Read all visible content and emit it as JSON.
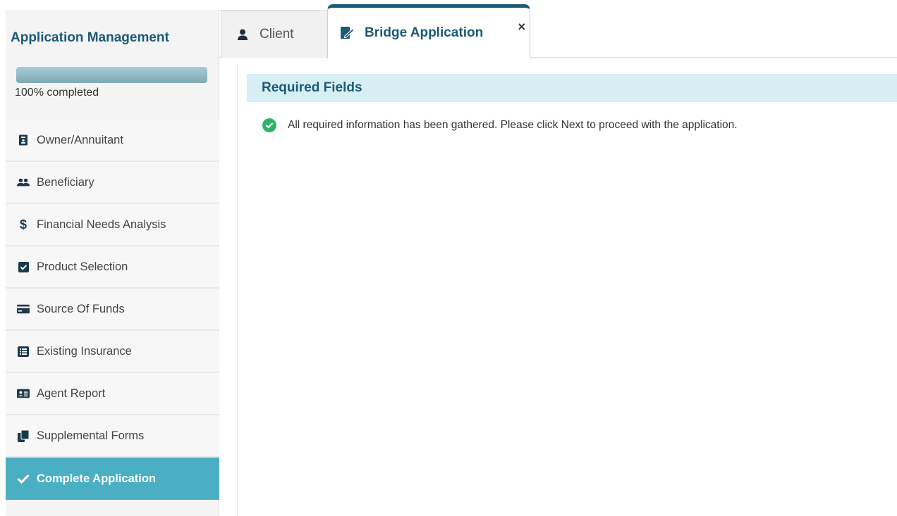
{
  "sidebar": {
    "title": "Application Management",
    "progress": {
      "percent": 100,
      "label": "100% completed"
    },
    "items": [
      {
        "label": "Owner/Annuitant",
        "icon": "id-badge-icon"
      },
      {
        "label": "Beneficiary",
        "icon": "users-icon"
      },
      {
        "label": "Financial Needs Analysis",
        "icon": "dollar-icon"
      },
      {
        "label": "Product Selection",
        "icon": "checkbox-icon"
      },
      {
        "label": "Source Of Funds",
        "icon": "credit-card-icon"
      },
      {
        "label": "Existing Insurance",
        "icon": "list-icon"
      },
      {
        "label": "Agent Report",
        "icon": "address-card-icon"
      },
      {
        "label": "Supplemental Forms",
        "icon": "copy-icon"
      },
      {
        "label": "Complete Application",
        "icon": "check-icon",
        "active": true
      }
    ]
  },
  "tabs": [
    {
      "label": "Client",
      "icon": "user-icon"
    },
    {
      "label": "Bridge Application",
      "icon": "file-signature-icon",
      "active": true,
      "close": "×"
    }
  ],
  "main": {
    "section_title": "Required Fields",
    "message": "All required information has been gathered. Please click Next to proceed with the application."
  },
  "colors": {
    "accent": "#1c5a78",
    "active_nav": "#4bafc4",
    "header_bg": "#d7eef3",
    "success": "#2fb36a"
  }
}
